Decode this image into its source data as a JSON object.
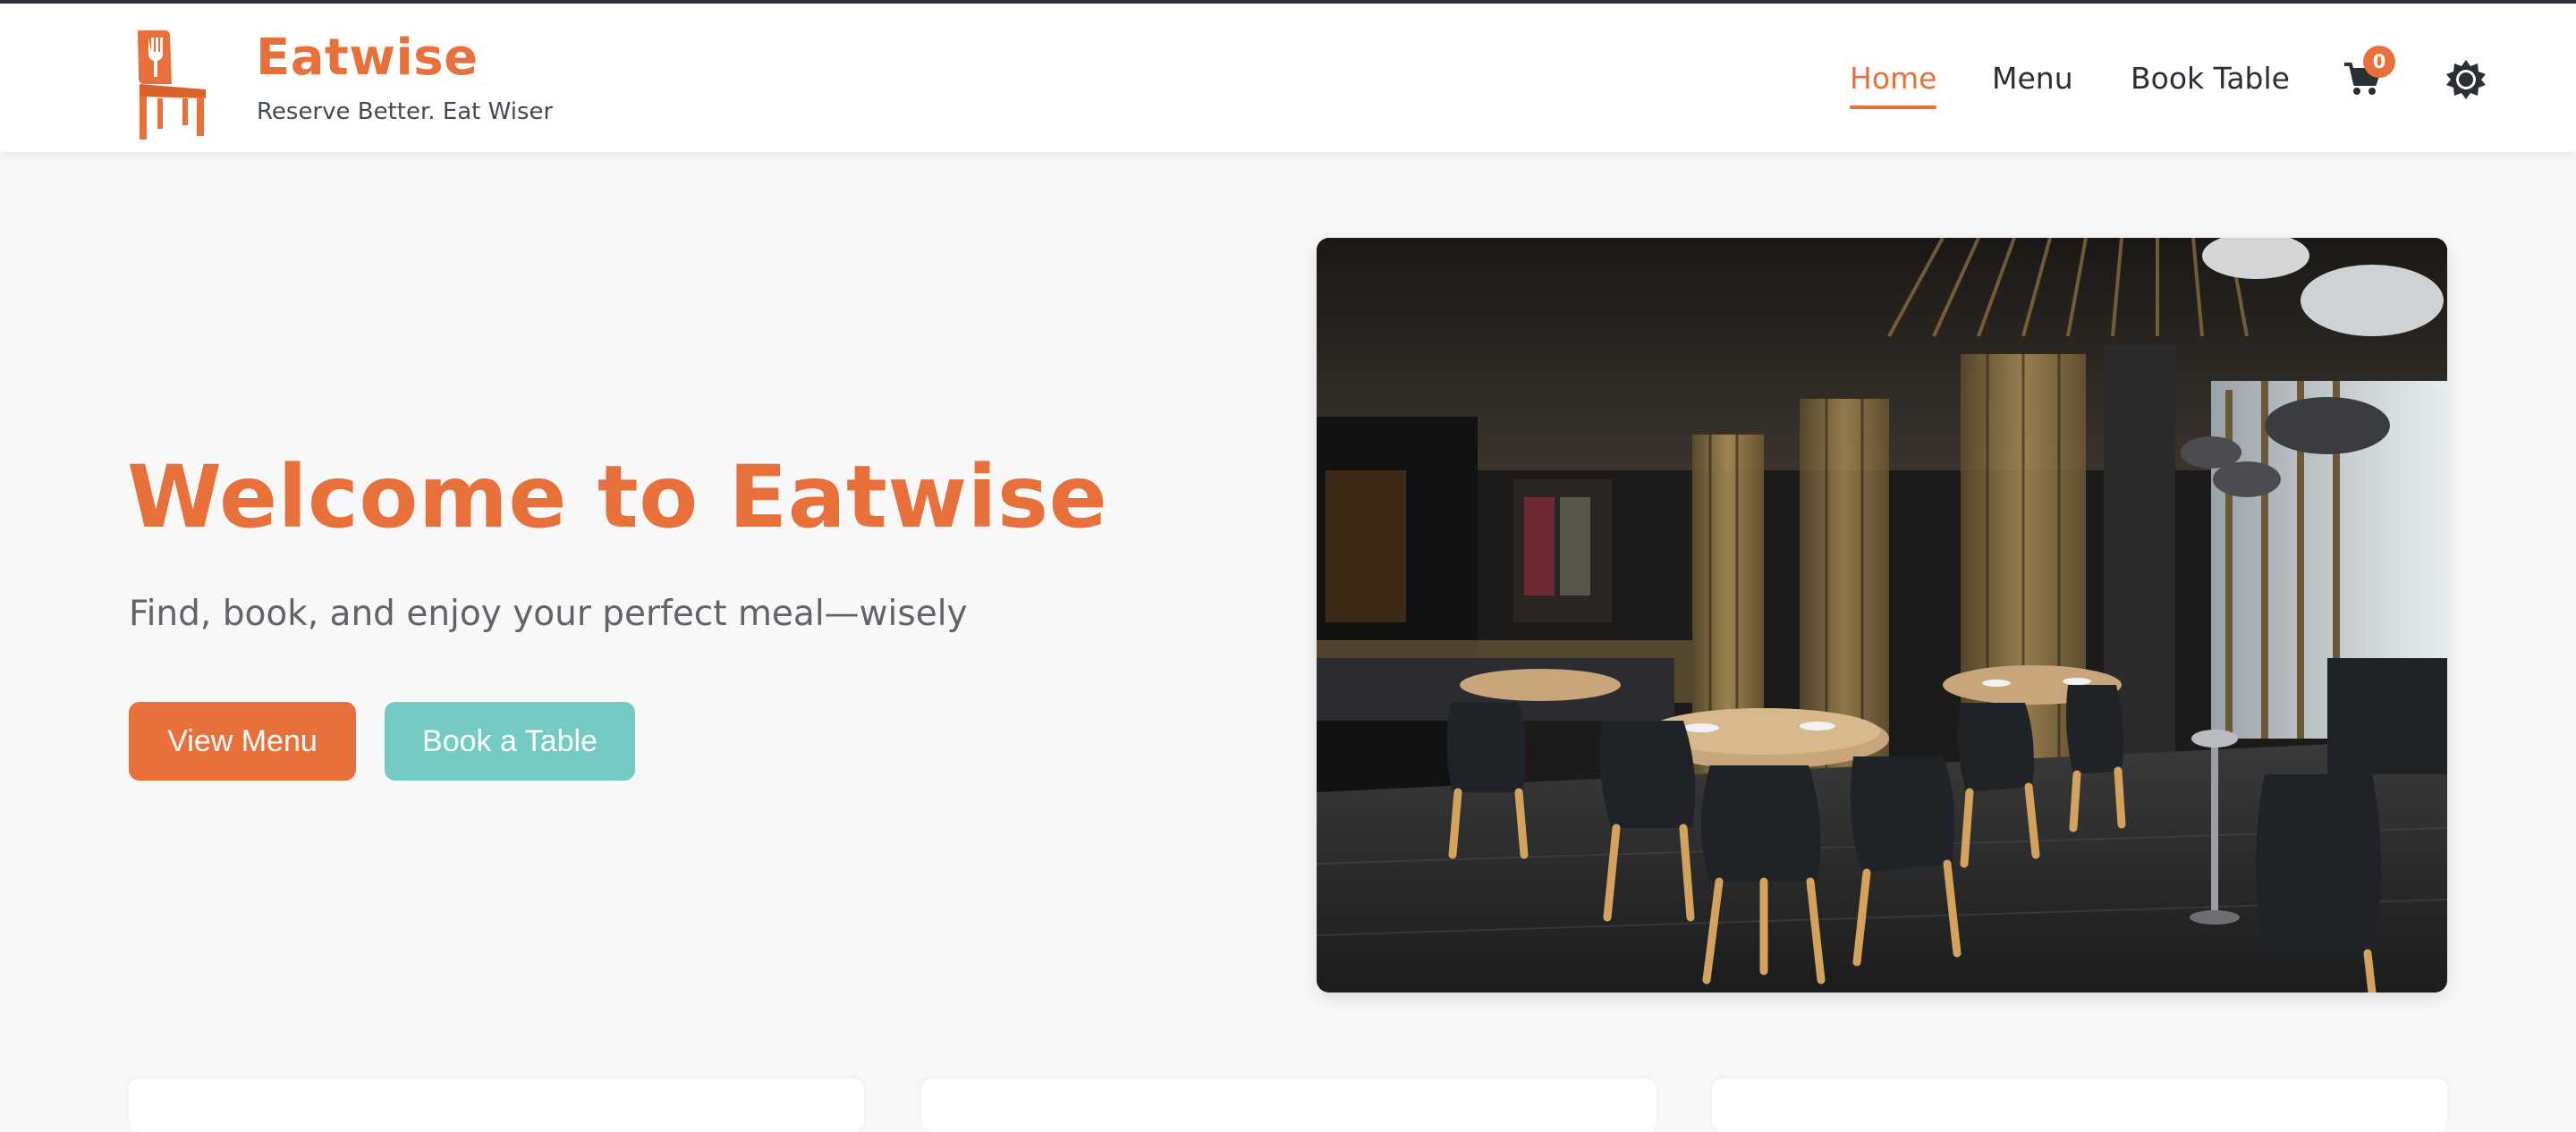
{
  "brand": {
    "name": "Eatwise",
    "tagline": "Reserve Better. Eat Wiser",
    "logo_icon": "chair-fork-icon"
  },
  "nav": {
    "items": [
      {
        "label": "Home",
        "active": true
      },
      {
        "label": "Menu",
        "active": false
      },
      {
        "label": "Book Table",
        "active": false
      }
    ],
    "cart_icon": "cart-icon",
    "cart_count": "0",
    "theme_icon": "sun-gear-icon"
  },
  "hero": {
    "title": "Welcome to Eatwise",
    "subtitle": "Find, book, and enjoy your perfect meal—wisely",
    "primary_button": "View Menu",
    "secondary_button": "Book a Table",
    "image_subject": "restaurant dining room with black chairs and round tables"
  },
  "colors": {
    "accent": "#e8703a",
    "secondary": "#74cbc4",
    "text_dark": "#2a2f36",
    "background": "#f8f8f8"
  }
}
